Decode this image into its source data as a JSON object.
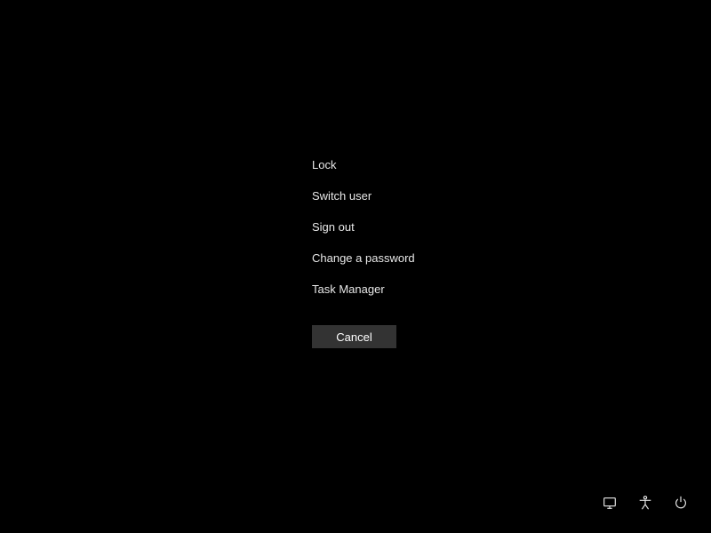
{
  "menu": {
    "items": [
      {
        "label": "Lock"
      },
      {
        "label": "Switch user"
      },
      {
        "label": "Sign out"
      },
      {
        "label": "Change a password"
      },
      {
        "label": "Task Manager"
      }
    ],
    "cancel_label": "Cancel"
  },
  "bottom_icons": {
    "network": "network-icon",
    "accessibility": "accessibility-icon",
    "power": "power-icon"
  }
}
